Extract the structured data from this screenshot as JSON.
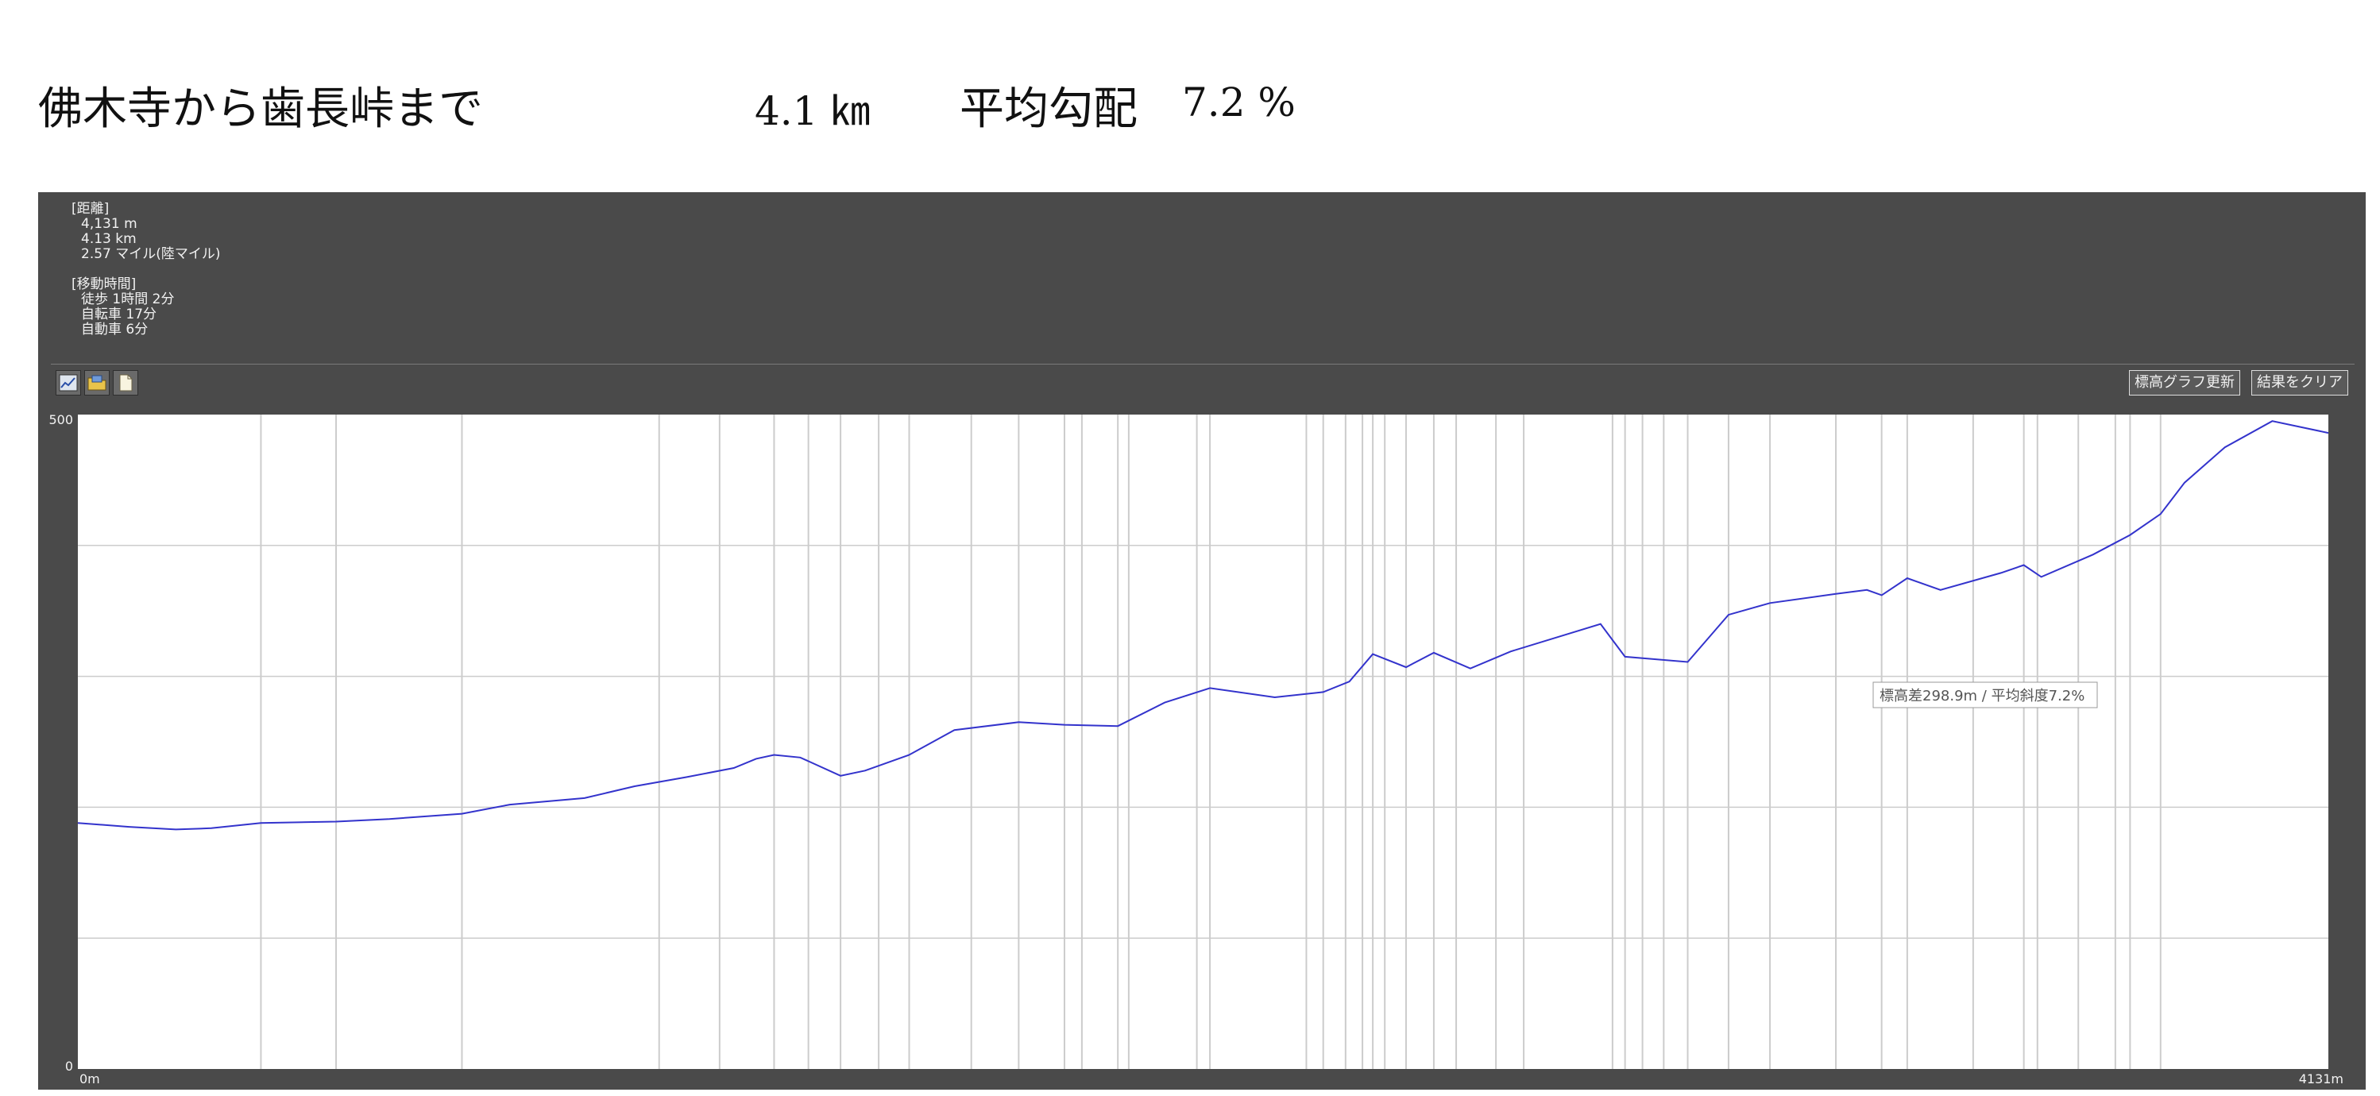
{
  "header": {
    "route": "佛木寺から歯長峠まで",
    "distance": "4.1 ㎞",
    "avg_gradient_label": "平均勾配",
    "avg_gradient_value": "7.2 %"
  },
  "info": {
    "distance_heading": "[距離]",
    "distance_m": "4,131 m",
    "distance_km": "4.13 km",
    "distance_mi": "2.57 マイル(陸マイル)",
    "time_heading": "[移動時間]",
    "walk": "徒歩 1時間 2分",
    "bike": "自転車 17分",
    "car": "自動車 6分"
  },
  "toolbar": {
    "refresh_label": "標高グラフ更新",
    "clear_label": "結果をクリア",
    "icons": [
      "chart-icon",
      "folder-icon",
      "document-icon"
    ]
  },
  "colors": {
    "line": "#3333cc",
    "panel": "#4a4a4a",
    "grid": "#cccccc"
  },
  "chart_data": {
    "type": "line",
    "y_tick_labels": [
      "500",
      "0"
    ],
    "x_tick_labels": [
      "0m",
      "4131m"
    ],
    "xlim": [
      0,
      4131
    ],
    "ylim": [
      0,
      500
    ],
    "grid": true,
    "annotation": "標高差298.9m / 平均斜度7.2%",
    "x_markers": [
      336,
      474,
      705,
      1067,
      1178,
      1278,
      1341,
      1400,
      1470,
      1526,
      1640,
      1727,
      1811,
      1843,
      1909,
      1929,
      2054,
      2078,
      2255,
      2286,
      2327,
      2358,
      2377,
      2399,
      2438,
      2489,
      2530,
      2603,
      2654,
      2817,
      2840,
      2872,
      2911,
      2955,
      3030,
      3106,
      3227,
      3311,
      3358,
      3479,
      3572,
      3597,
      3672,
      3740,
      3767,
      3823
    ],
    "series": [
      {
        "x": [
          0,
          94,
          180,
          245,
          336,
          474,
          572,
          705,
          793,
          930,
          1022,
          1117,
          1204,
          1245,
          1278,
          1326,
          1400,
          1445,
          1526,
          1609,
          1727,
          1811,
          1909,
          1995,
          2078,
          2197,
          2286,
          2334,
          2377,
          2438,
          2489,
          2556,
          2630,
          2795,
          2840,
          2955,
          3030,
          3106,
          3227,
          3284,
          3311,
          3358,
          3419,
          3530,
          3572,
          3604,
          3699,
          3767,
          3823,
          3867,
          3941,
          4028,
          4131
        ],
        "y": [
          188,
          185,
          183,
          184,
          188,
          189,
          191,
          195,
          202,
          207,
          216,
          223,
          230,
          237,
          240,
          238,
          224,
          228,
          240,
          259,
          265,
          263,
          262,
          280,
          291,
          284,
          288,
          296,
          317,
          307,
          318,
          306,
          319,
          340,
          315,
          311,
          347,
          356,
          363,
          366,
          362,
          375,
          366,
          379,
          385,
          376,
          393,
          408,
          424,
          448,
          475,
          495,
          486
        ]
      }
    ]
  }
}
